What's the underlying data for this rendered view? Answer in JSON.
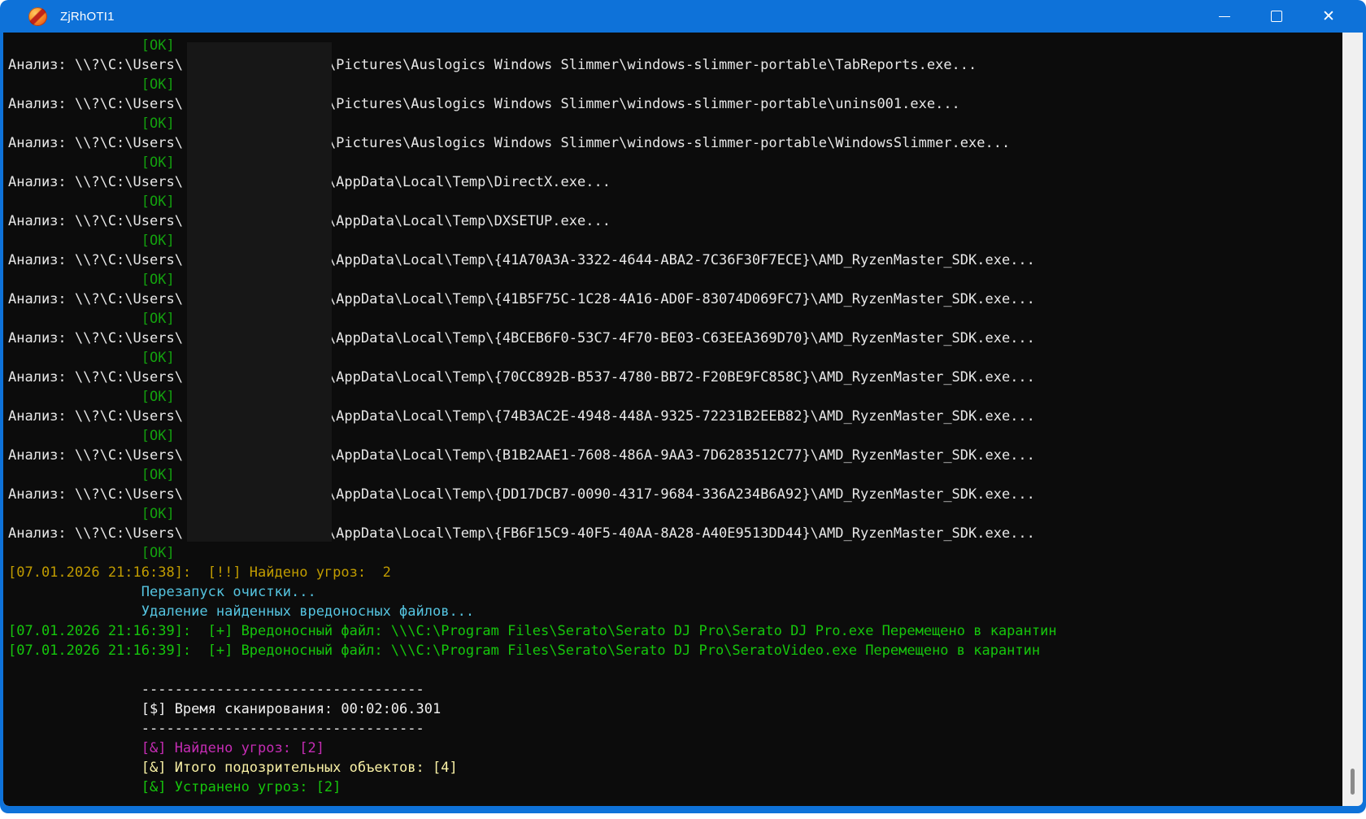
{
  "window": {
    "title": "ZjRhOTI1",
    "app_icon": "fireball-scanner-icon",
    "controls": [
      {
        "name": "minimize",
        "glyph": ""
      },
      {
        "name": "maximize",
        "glyph": ""
      },
      {
        "name": "close",
        "glyph": "✕"
      }
    ]
  },
  "colors": {
    "titlebar_blue": "#0E72D9",
    "console_bg": "#0C0C0C",
    "redaction": "#171717",
    "scrollbar_track": "#F0F0F0",
    "scrollbar_thumb": "#8A8A8A",
    "fg": "#E8E8E8",
    "ok": "#13A10E",
    "green": "#16C60C",
    "gold": "#C19C00",
    "cyan": "#55C4E0",
    "white": "#F2F2F2",
    "magenta": "#C52CB4",
    "cream": "#F9F1A5"
  },
  "console": {
    "colors": {
      "fg": "#E8E8E8",
      "ok": "#13A10E",
      "green": "#16C60C",
      "gold": "#C19C00",
      "cyan": "#55C4E0",
      "white": "#F2F2F2",
      "magenta": "#C52CB4",
      "cream": "#F9F1A5"
    },
    "lines": [
      {
        "c": "ok",
        "t": "                [OK]"
      },
      {
        "c": "fg",
        "p": "Анализ: \\\\?\\C:\\Users\\",
        "r": "\\Pictures\\Auslogics Windows Slimmer\\windows-slimmer-portable\\TabReports.exe..."
      },
      {
        "c": "ok",
        "t": "                [OK]"
      },
      {
        "c": "fg",
        "p": "Анализ: \\\\?\\C:\\Users\\",
        "r": "\\Pictures\\Auslogics Windows Slimmer\\windows-slimmer-portable\\unins001.exe..."
      },
      {
        "c": "ok",
        "t": "                [OK]"
      },
      {
        "c": "fg",
        "p": "Анализ: \\\\?\\C:\\Users\\",
        "r": "\\Pictures\\Auslogics Windows Slimmer\\windows-slimmer-portable\\WindowsSlimmer.exe..."
      },
      {
        "c": "ok",
        "t": "                [OK]"
      },
      {
        "c": "fg",
        "p": "Анализ: \\\\?\\C:\\Users\\",
        "r": "\\AppData\\Local\\Temp\\DirectX.exe..."
      },
      {
        "c": "ok",
        "t": "                [OK]"
      },
      {
        "c": "fg",
        "p": "Анализ: \\\\?\\C:\\Users\\",
        "r": "\\AppData\\Local\\Temp\\DXSETUP.exe..."
      },
      {
        "c": "ok",
        "t": "                [OK]"
      },
      {
        "c": "fg",
        "p": "Анализ: \\\\?\\C:\\Users\\",
        "r": "\\AppData\\Local\\Temp\\{41A70A3A-3322-4644-ABA2-7C36F30F7ECE}\\AMD_RyzenMaster_SDK.exe..."
      },
      {
        "c": "ok",
        "t": "                [OK]"
      },
      {
        "c": "fg",
        "p": "Анализ: \\\\?\\C:\\Users\\",
        "r": "\\AppData\\Local\\Temp\\{41B5F75C-1C28-4A16-AD0F-83074D069FC7}\\AMD_RyzenMaster_SDK.exe..."
      },
      {
        "c": "ok",
        "t": "                [OK]"
      },
      {
        "c": "fg",
        "p": "Анализ: \\\\?\\C:\\Users\\",
        "r": "\\AppData\\Local\\Temp\\{4BCEB6F0-53C7-4F70-BE03-C63EEA369D70}\\AMD_RyzenMaster_SDK.exe..."
      },
      {
        "c": "ok",
        "t": "                [OK]"
      },
      {
        "c": "fg",
        "p": "Анализ: \\\\?\\C:\\Users\\",
        "r": "\\AppData\\Local\\Temp\\{70CC892B-B537-4780-BB72-F20BE9FC858C}\\AMD_RyzenMaster_SDK.exe..."
      },
      {
        "c": "ok",
        "t": "                [OK]"
      },
      {
        "c": "fg",
        "p": "Анализ: \\\\?\\C:\\Users\\",
        "r": "\\AppData\\Local\\Temp\\{74B3AC2E-4948-448A-9325-72231B2EEB82}\\AMD_RyzenMaster_SDK.exe..."
      },
      {
        "c": "ok",
        "t": "                [OK]"
      },
      {
        "c": "fg",
        "p": "Анализ: \\\\?\\C:\\Users\\",
        "r": "\\AppData\\Local\\Temp\\{B1B2AAE1-7608-486A-9AA3-7D6283512C77}\\AMD_RyzenMaster_SDK.exe..."
      },
      {
        "c": "ok",
        "t": "                [OK]"
      },
      {
        "c": "fg",
        "p": "Анализ: \\\\?\\C:\\Users\\",
        "r": "\\AppData\\Local\\Temp\\{DD17DCB7-0090-4317-9684-336A234B6A92}\\AMD_RyzenMaster_SDK.exe..."
      },
      {
        "c": "ok",
        "t": "                [OK]"
      },
      {
        "c": "fg",
        "p": "Анализ: \\\\?\\C:\\Users\\",
        "r": "\\AppData\\Local\\Temp\\{FB6F15C9-40F5-40AA-8A28-A40E9513DD44}\\AMD_RyzenMaster_SDK.exe..."
      },
      {
        "c": "ok",
        "t": "                [OK]"
      },
      {
        "c": "gold",
        "t": "[07.01.2026 21:16:38]:  [!!] Найдено угроз:  2"
      },
      {
        "c": "cyan",
        "t": "                Перезапуск очистки..."
      },
      {
        "c": "cyan",
        "t": "                Удаление найденных вредоносных файлов..."
      },
      {
        "c": "green",
        "t": "[07.01.2026 21:16:39]:  [+] Вредоносный файл: \\\\\\C:\\Program Files\\Serato\\Serato DJ Pro\\Serato DJ Pro.exe Перемещено в карантин"
      },
      {
        "c": "green",
        "t": "[07.01.2026 21:16:39]:  [+] Вредоносный файл: \\\\\\C:\\Program Files\\Serato\\Serato DJ Pro\\SeratoVideo.exe Перемещено в карантин"
      },
      {
        "c": "fg",
        "t": " "
      },
      {
        "c": "white",
        "t": "                ----------------------------------"
      },
      {
        "c": "white",
        "t": "                [$] Время сканирования: 00:02:06.301"
      },
      {
        "c": "white",
        "t": "                ----------------------------------"
      },
      {
        "c": "magenta",
        "t": "                [&] Найдено угроз: [2]"
      },
      {
        "c": "cream",
        "t": "                [&] Итого подозрительных объектов: [4]"
      },
      {
        "c": "green",
        "t": "                [&] Устранено угроз: [2]"
      }
    ]
  }
}
